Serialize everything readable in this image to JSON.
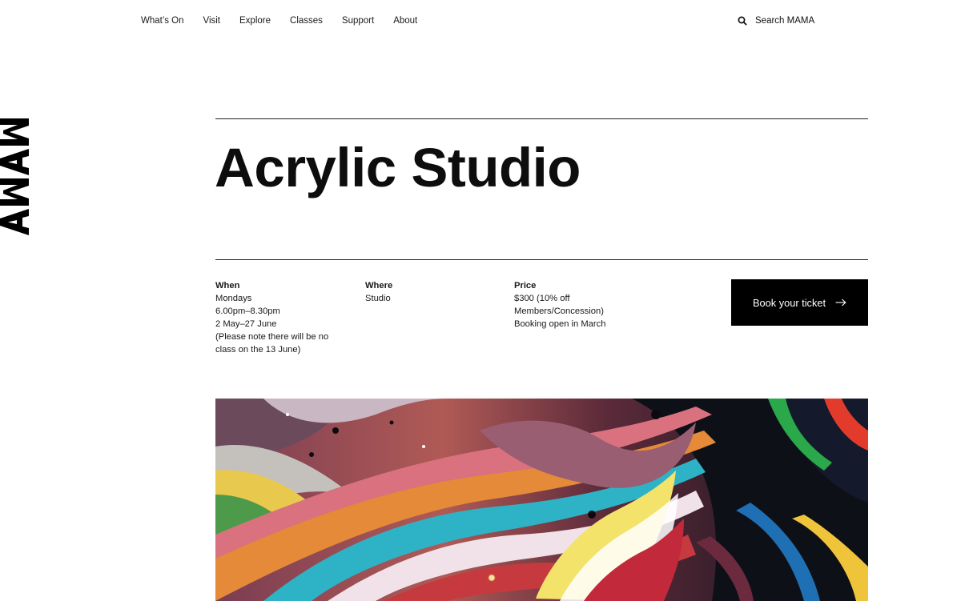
{
  "nav": {
    "items": [
      {
        "label": "What’s On"
      },
      {
        "label": "Visit"
      },
      {
        "label": "Explore"
      },
      {
        "label": "Classes"
      },
      {
        "label": "Support"
      },
      {
        "label": "About"
      }
    ],
    "search_label": "Search MAMA",
    "search_icon": "search-icon"
  },
  "logo": {
    "text": "MAMA",
    "orientation": "vertical"
  },
  "page": {
    "title": "Acrylic Studio"
  },
  "details": {
    "when": {
      "heading": "When",
      "lines": [
        "Mondays",
        "6.00pm–8.30pm",
        "2 May–27 June",
        "(Please note there will be no",
        "class on the 13 June)"
      ]
    },
    "where": {
      "heading": "Where",
      "lines": [
        "Studio"
      ]
    },
    "price": {
      "heading": "Price",
      "lines": [
        "$300 (10% off",
        "Members/Concession)",
        "Booking open in March"
      ]
    }
  },
  "cta": {
    "label": "Book your ticket",
    "icon": "arrow-right-icon"
  },
  "hero": {
    "image": "colorful-acrylic-paint-pour",
    "colors": [
      "#0b0b12",
      "#d3333a",
      "#2fb6c8",
      "#f2d34a",
      "#e87a2a",
      "#3aa84b",
      "#f4e8ee",
      "#8d5a6e"
    ]
  }
}
